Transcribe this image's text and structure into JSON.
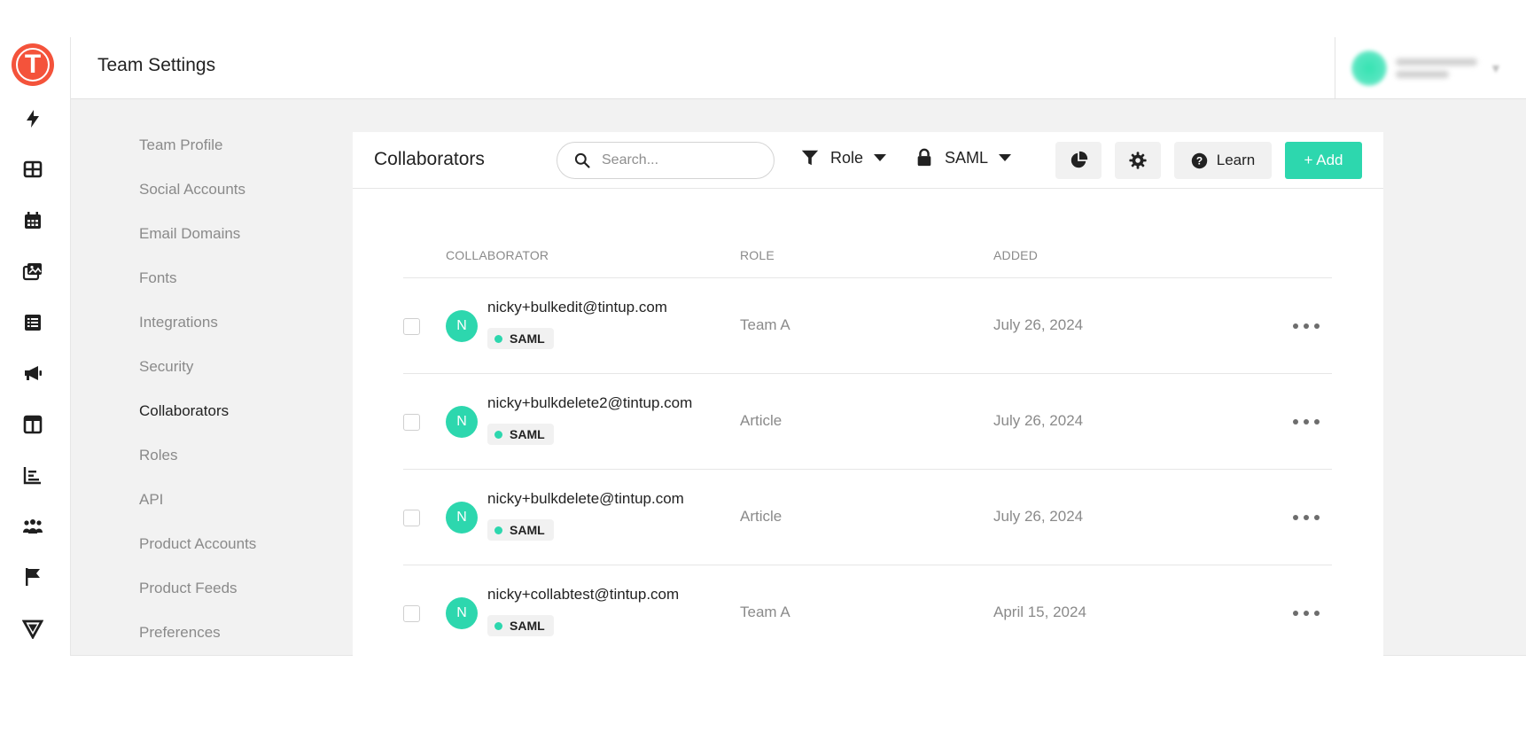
{
  "header": {
    "title": "Team Settings"
  },
  "logo": {
    "letter": "T"
  },
  "rail": {
    "icons": [
      "bolt-icon",
      "grid-icon",
      "calendar-icon",
      "media-icon",
      "list-icon",
      "megaphone-icon",
      "layout-icon",
      "bar-chart-icon",
      "people-icon",
      "flag-icon",
      "triangle-logo-icon"
    ]
  },
  "settings_nav": {
    "items": [
      {
        "label": "Team Profile"
      },
      {
        "label": "Social Accounts"
      },
      {
        "label": "Email Domains"
      },
      {
        "label": "Fonts"
      },
      {
        "label": "Integrations"
      },
      {
        "label": "Security"
      },
      {
        "label": "Collaborators"
      },
      {
        "label": "Roles"
      },
      {
        "label": "API"
      },
      {
        "label": "Product Accounts"
      },
      {
        "label": "Product Feeds"
      },
      {
        "label": "Preferences"
      }
    ],
    "active": "Collaborators"
  },
  "panel": {
    "title": "Collaborators",
    "search_placeholder": "Search...",
    "role_filter": "Role",
    "saml_filter": "SAML",
    "learn_label": "Learn",
    "add_label": "+ Add"
  },
  "table": {
    "columns": [
      "COLLABORATOR",
      "ROLE",
      "ADDED"
    ],
    "rows": [
      {
        "initial": "N",
        "email": "nicky+bulkedit@tintup.com",
        "badge": "SAML",
        "role": "Team A",
        "added": "July 26, 2024"
      },
      {
        "initial": "N",
        "email": "nicky+bulkdelete2@tintup.com",
        "badge": "SAML",
        "role": "Article",
        "added": "July 26, 2024"
      },
      {
        "initial": "N",
        "email": "nicky+bulkdelete@tintup.com",
        "badge": "SAML",
        "role": "Article",
        "added": "July 26, 2024"
      },
      {
        "initial": "N",
        "email": "nicky+collabtest@tintup.com",
        "badge": "SAML",
        "role": "Team A",
        "added": "April 15, 2024"
      }
    ]
  },
  "colors": {
    "accent": "#2dd7ae",
    "logo": "#f4533b"
  }
}
